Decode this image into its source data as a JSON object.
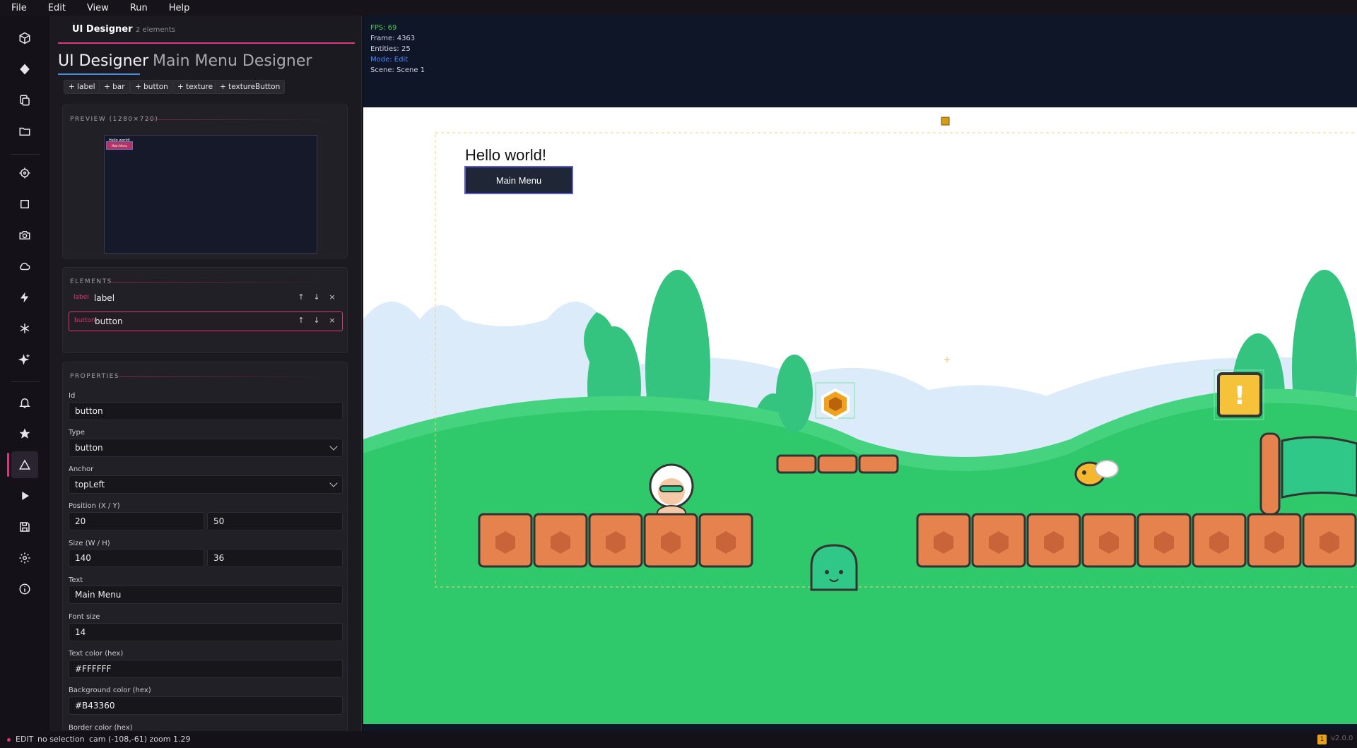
{
  "menu": [
    "File",
    "Edit",
    "View",
    "Run",
    "Help"
  ],
  "panel": {
    "title": "UI Designer",
    "count": "2 elements",
    "tabs": [
      "UI Designer",
      "Main Menu Designer"
    ],
    "add_buttons": [
      "+ label",
      "+ bar",
      "+ button",
      "+ texture",
      "+ textureButton"
    ],
    "preview": {
      "title": "PREVIEW (1280×720)",
      "label_text": "Hello world!",
      "button_text": "Main Menu"
    },
    "elements": {
      "title": "ELEMENTS",
      "rows": [
        {
          "type": "label",
          "name": "label"
        },
        {
          "type": "button",
          "name": "button"
        }
      ],
      "actions": [
        "↑",
        "↓",
        "×"
      ]
    },
    "properties": {
      "title": "PROPERTIES",
      "id_label": "Id",
      "id_value": "button",
      "type_label": "Type",
      "type_value": "button",
      "anchor_label": "Anchor",
      "anchor_value": "topLeft",
      "position_label": "Position (X / Y)",
      "position_x": "20",
      "position_y": "50",
      "size_label": "Size (W / H)",
      "size_w": "140",
      "size_h": "36",
      "text_label": "Text",
      "text_value": "Main Menu",
      "font_size_label": "Font size",
      "font_size_value": "14",
      "text_color_label": "Text color (hex)",
      "text_color_value": "#FFFFFF",
      "bg_color_label": "Background color (hex)",
      "bg_color_value": "#B43360",
      "border_color_label": "Border color (hex)"
    }
  },
  "viewport": {
    "fps": "FPS: 69",
    "frame": "Frame: 4363",
    "entities": "Entities: 25",
    "mode": "Mode: Edit",
    "scene": "Scene: Scene 1",
    "ui_label": "Hello world!",
    "ui_button": "Main Menu"
  },
  "status": {
    "mode": "EDIT",
    "selection": "no selection",
    "cam": "cam (-108,-61) zoom 1.29",
    "badge": "1",
    "version": "v2.0.0"
  },
  "icons": [
    "cube-icon",
    "diamond-icon",
    "copy-icon",
    "folder-icon",
    "crosshair-icon",
    "square-icon",
    "camera-icon",
    "cloud-icon",
    "lightning-icon",
    "asterisk-icon",
    "sparkle-icon",
    "bell-icon",
    "star-icon",
    "triangle-icon",
    "play-icon",
    "save-icon",
    "gear-icon",
    "info-icon"
  ],
  "colors": {
    "accent": "#e0357c",
    "button_bg": "#B43360",
    "blue": "#4a8be0"
  }
}
